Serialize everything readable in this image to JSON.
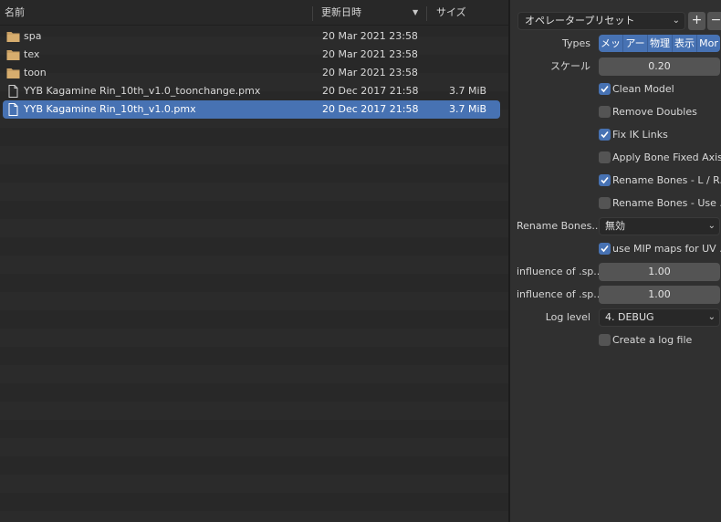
{
  "browser": {
    "columns": {
      "name": "名前",
      "date": "更新日時",
      "size": "サイズ",
      "sort_icon": "sort-descending-icon"
    },
    "files": [
      {
        "type": "folder",
        "icon": "folder-icon",
        "name": "spa",
        "date": "20 Mar 2021 23:58",
        "size": "",
        "selected": false
      },
      {
        "type": "folder",
        "icon": "folder-icon",
        "name": "tex",
        "date": "20 Mar 2021 23:58",
        "size": "",
        "selected": false
      },
      {
        "type": "folder",
        "icon": "folder-icon",
        "name": "toon",
        "date": "20 Mar 2021 23:58",
        "size": "",
        "selected": false
      },
      {
        "type": "file",
        "icon": "file-icon",
        "name": "YYB Kagamine Rin_10th_v1.0_toonchange.pmx",
        "date": "20 Dec 2017 21:58",
        "size": "3.7 MiB",
        "selected": false
      },
      {
        "type": "file",
        "icon": "file-icon",
        "name": "YYB Kagamine Rin_10th_v1.0.pmx",
        "date": "20 Dec 2017 21:58",
        "size": "3.7 MiB",
        "selected": true
      }
    ]
  },
  "panel": {
    "preset": {
      "label": "オペレータープリセット",
      "add": "+",
      "remove": "−"
    },
    "types": {
      "label": "Types",
      "buttons": [
        "メッ",
        "アー",
        "物理",
        "表示",
        "Mor"
      ]
    },
    "scale": {
      "label": "スケール",
      "value": "0.20"
    },
    "checks": {
      "clean_model": {
        "label": "Clean Model",
        "checked": true
      },
      "remove_doubles": {
        "label": "Remove Doubles",
        "checked": false
      },
      "fix_ik_links": {
        "label": "Fix IK Links",
        "checked": true
      },
      "apply_bone_fixed_axis": {
        "label": "Apply Bone Fixed Axis",
        "checked": false
      },
      "rename_bones_lr": {
        "label": "Rename Bones - L / R...",
        "checked": true
      },
      "rename_bones_use": {
        "label": "Rename Bones - Use ...",
        "checked": false
      },
      "use_mip_maps": {
        "label": "use MIP maps for UV ...",
        "checked": true
      },
      "create_log_file": {
        "label": "Create a log file",
        "checked": false
      }
    },
    "rename_bones_dropdown": {
      "label": "Rename Bones...",
      "value": "無効"
    },
    "influence_1": {
      "label": "influence of .sp...",
      "value": "1.00"
    },
    "influence_2": {
      "label": "influence of .sp...",
      "value": "1.00"
    },
    "log_level": {
      "label": "Log level",
      "value": "4. DEBUG"
    }
  },
  "colors": {
    "accent": "#4772b3",
    "background": "#2b2b2b",
    "panel": "#303030",
    "field": "#545454",
    "folder": "#c9a064"
  }
}
